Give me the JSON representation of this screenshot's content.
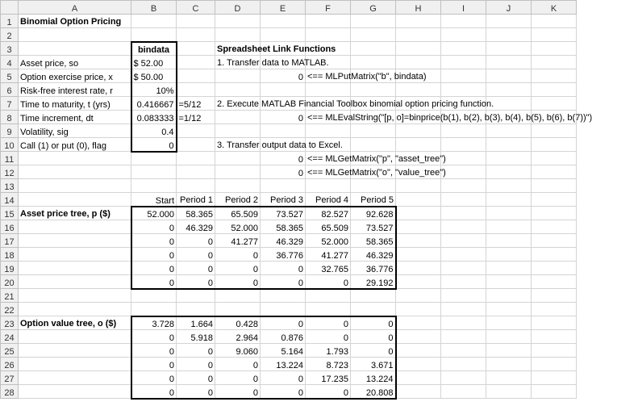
{
  "columns": [
    "",
    "A",
    "B",
    "C",
    "D",
    "E",
    "F",
    "G",
    "H",
    "I",
    "J",
    "K"
  ],
  "title": "Binomial Option Pricing",
  "bindata_label": "bindata",
  "inputs": {
    "asset_price_label": "Asset price, so",
    "asset_price_val": "$   52.00",
    "exercise_label": "Option exercise price, x",
    "exercise_val": "$   50.00",
    "rate_label": "Risk-free interest rate, r",
    "rate_val": "10%",
    "maturity_label": "Time to maturity, t (yrs)",
    "maturity_val": "0.416667",
    "maturity_formula": "=5/12",
    "increment_label": "Time increment, dt",
    "increment_val": "0.083333",
    "increment_formula": "=1/12",
    "vol_label": "Volatility, sig",
    "vol_val": "0.4",
    "flag_label": "Call (1) or put (0), flag",
    "flag_val": "0"
  },
  "functions_title": "Spreadsheet Link Functions",
  "step1": "1.  Transfer data to MATLAB.",
  "step1_res": "0",
  "step1_call": "<== MLPutMatrix(\"b\", bindata)",
  "step2": "2.  Execute MATLAB Financial Toolbox binomial option pricing function.",
  "step2_res": "0",
  "step2_call": "<== MLEvalString(\"[p, o]=binprice(b(1), b(2), b(3), b(4), b(5), b(6), b(7))\")",
  "step3": "3.  Transfer output data to Excel.",
  "step3a_res": "0",
  "step3a_call": "<== MLGetMatrix(\"p\", \"asset_tree\")",
  "step3b_res": "0",
  "step3b_call": "<== MLGetMatrix(\"o\", \"value_tree\")",
  "periods": {
    "start": "Start",
    "p1": "Period 1",
    "p2": "Period 2",
    "p3": "Period 3",
    "p4": "Period 4",
    "p5": "Period 5"
  },
  "asset_tree_label": "Asset price tree, p ($)",
  "asset_tree": [
    [
      "52.000",
      "58.365",
      "65.509",
      "73.527",
      "82.527",
      "92.628"
    ],
    [
      "0",
      "46.329",
      "52.000",
      "58.365",
      "65.509",
      "73.527"
    ],
    [
      "0",
      "0",
      "41.277",
      "46.329",
      "52.000",
      "58.365"
    ],
    [
      "0",
      "0",
      "0",
      "36.776",
      "41.277",
      "46.329"
    ],
    [
      "0",
      "0",
      "0",
      "0",
      "32.765",
      "36.776"
    ],
    [
      "0",
      "0",
      "0",
      "0",
      "0",
      "29.192"
    ]
  ],
  "value_tree_label": "Option value tree, o ($)",
  "value_tree": [
    [
      "3.728",
      "1.664",
      "0.428",
      "0",
      "0",
      "0"
    ],
    [
      "0",
      "5.918",
      "2.964",
      "0.876",
      "0",
      "0"
    ],
    [
      "0",
      "0",
      "9.060",
      "5.164",
      "1.793",
      "0"
    ],
    [
      "0",
      "0",
      "0",
      "13.224",
      "8.723",
      "3.671"
    ],
    [
      "0",
      "0",
      "0",
      "0",
      "17.235",
      "13.224"
    ],
    [
      "0",
      "0",
      "0",
      "0",
      "0",
      "20.808"
    ]
  ],
  "chart_data": {
    "type": "table",
    "title": "Binomial Option Pricing",
    "inputs": {
      "asset_price": 52.0,
      "exercise_price": 50.0,
      "risk_free_rate": 0.1,
      "time_to_maturity_yrs": 0.416667,
      "time_increment": 0.083333,
      "volatility": 0.4,
      "call_put_flag": 0
    },
    "asset_price_tree": [
      [
        52.0,
        58.365,
        65.509,
        73.527,
        82.527,
        92.628
      ],
      [
        0,
        46.329,
        52.0,
        58.365,
        65.509,
        73.527
      ],
      [
        0,
        0,
        41.277,
        46.329,
        52.0,
        58.365
      ],
      [
        0,
        0,
        0,
        36.776,
        41.277,
        46.329
      ],
      [
        0,
        0,
        0,
        0,
        32.765,
        36.776
      ],
      [
        0,
        0,
        0,
        0,
        0,
        29.192
      ]
    ],
    "option_value_tree": [
      [
        3.728,
        1.664,
        0.428,
        0,
        0,
        0
      ],
      [
        0,
        5.918,
        2.964,
        0.876,
        0,
        0
      ],
      [
        0,
        0,
        9.06,
        5.164,
        1.793,
        0
      ],
      [
        0,
        0,
        0,
        13.224,
        8.723,
        3.671
      ],
      [
        0,
        0,
        0,
        0,
        17.235,
        13.224
      ],
      [
        0,
        0,
        0,
        0,
        0,
        20.808
      ]
    ]
  }
}
